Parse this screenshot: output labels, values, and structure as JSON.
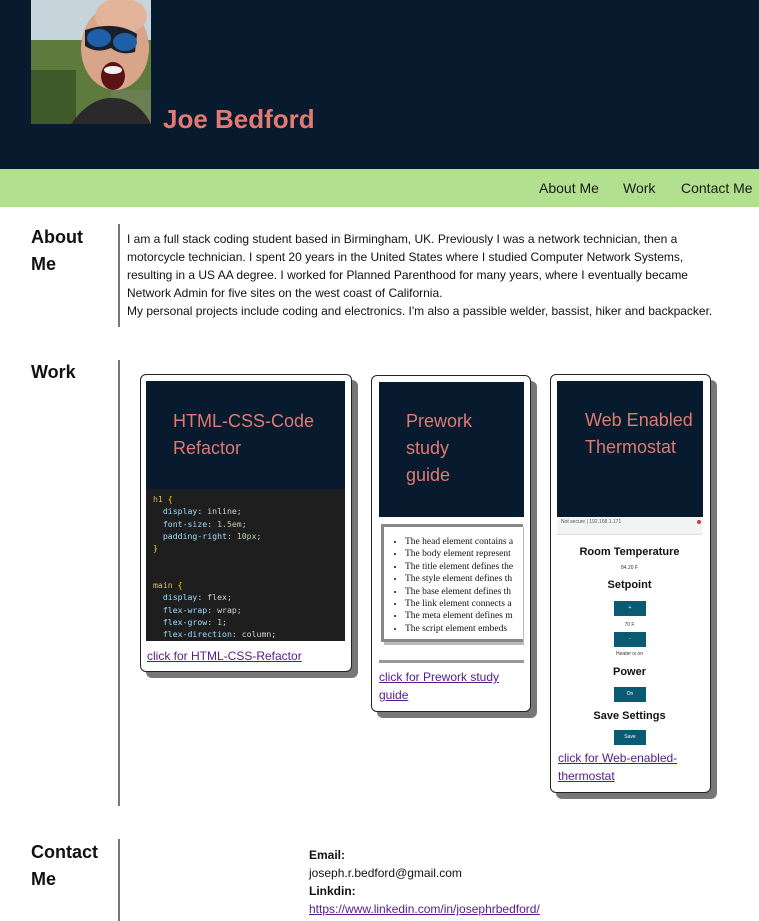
{
  "header": {
    "name": "Joe Bedford",
    "avatar_icon": "profile-photo",
    "background_color": "#081a2e",
    "name_color": "#e07a73"
  },
  "nav": {
    "background_color": "#b3e08f",
    "items": [
      {
        "label": "About Me"
      },
      {
        "label": "Work"
      },
      {
        "label": "Contact Me"
      }
    ]
  },
  "about": {
    "heading": "About Me",
    "paragraph1": "I am a full stack coding student based in Birmingham, UK. Previously I was a network technician, then a motorcycle technician. I spent 20 years in the United States where I studied Computer Network Systems, resulting in a US AA degree. I worked for Planned Parenthood for many years, where I eventually became Network Admin for five sites on the west coast of California.",
    "paragraph2": "My personal projects include coding and electronics. I'm also a passible welder, bassist, hiker and backpacker."
  },
  "work": {
    "heading": "Work",
    "cards": [
      {
        "thumb_title": "HTML-CSS-Code Refactor",
        "link_text": "click for HTML-CSS-Refactor",
        "code_lines": [
          "h1 {",
          "  display: inline;",
          "  font-size: 1.5em;",
          "  padding-right: 10px;",
          "}",
          "",
          "",
          "main {",
          "  display: flex;",
          "  flex-wrap: wrap;",
          "  flex-grow: 1;",
          "  flex-direction: column;"
        ]
      },
      {
        "thumb_title": "Prework study guide",
        "link_text": "click for Prework study guide",
        "list_items": [
          "The head element contains a",
          "The body element represent",
          "The title element defines the",
          "The style element defines th",
          "The base element defines th",
          "The link element connects a",
          "The meta element defines m",
          "The script element embeds"
        ]
      },
      {
        "thumb_title": "Web Enabled Thermostat",
        "link_text": "click for Web-enabled-thermostat",
        "screenshot": {
          "url_text": "Not secure | 192.168.1.171",
          "room_temp_label": "Room Temperature",
          "room_temp_value": "84.20 F",
          "setpoint_label": "Setpoint",
          "setpoint_up": "+",
          "setpoint_value": "70 F",
          "setpoint_down": "-",
          "heater_status": "Heater is on",
          "power_label": "Power",
          "power_button": "On",
          "save_label": "Save Settings",
          "save_button": "Save"
        }
      }
    ]
  },
  "contact": {
    "heading": "Contact Me",
    "email_label": "Email:",
    "email": "joseph.r.bedford@gmail.com",
    "linkedin_label": "Linkdin:",
    "linkedin_url": "https://www.linkedin.com/in/josephrbedford/"
  }
}
